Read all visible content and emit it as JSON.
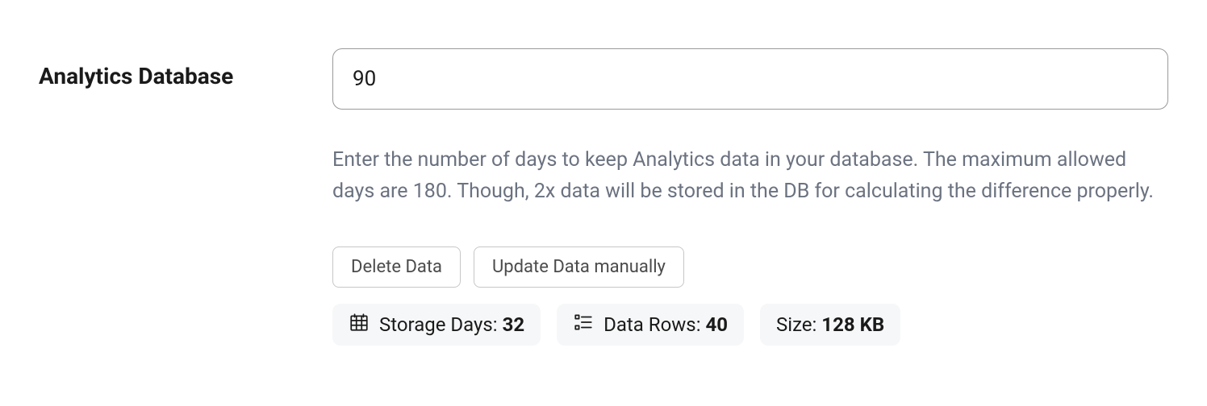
{
  "section": {
    "title": "Analytics Database",
    "input_value": "90",
    "help_text": "Enter the number of days to keep Analytics data in your database. The maximum allowed days are 180. Though, 2x data will be stored in the DB for calculating the difference properly."
  },
  "buttons": {
    "delete_label": "Delete Data",
    "update_label": "Update Data manually"
  },
  "badges": {
    "storage_label": "Storage Days: ",
    "storage_value": "32",
    "rows_label": "Data Rows: ",
    "rows_value": "40",
    "size_label": "Size: ",
    "size_value": "128 KB"
  }
}
